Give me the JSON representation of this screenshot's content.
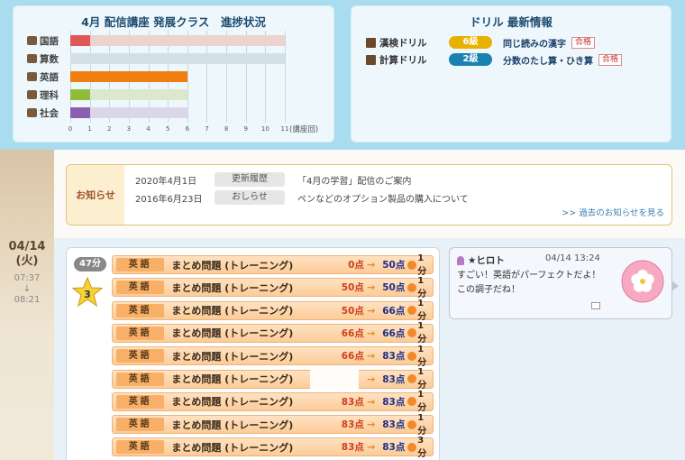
{
  "progress": {
    "title": "4月 配信講座 発展クラス　進捗状況",
    "unit": "(講座回)",
    "chart_data": {
      "type": "bar",
      "orientation": "horizontal",
      "categories": [
        "国語",
        "算数",
        "英語",
        "理科",
        "社会"
      ],
      "series": [
        {
          "values": [
            1,
            0,
            6,
            1,
            1
          ]
        }
      ],
      "totals": [
        11,
        11,
        6,
        6,
        6
      ],
      "colors": [
        "#e05757",
        "#a8bfd6",
        "#f07f10",
        "#8fbd3a",
        "#8a5fb0"
      ],
      "track_colors": [
        "#ecd3cf",
        "#d3e0e8",
        "#f7dcc0",
        "#dce8cc",
        "#dcd6ea"
      ],
      "xticks": [
        0,
        1,
        2,
        3,
        4,
        5,
        6,
        7,
        8,
        9,
        10,
        11
      ],
      "xlim": [
        0,
        11
      ]
    }
  },
  "drill": {
    "title": "ドリル 最新情報",
    "items": [
      {
        "name": "漢検ドリル",
        "level": "6級",
        "level_color": "#e8b100",
        "unit": "同じ読みの漢字",
        "result": "合格"
      },
      {
        "name": "計算ドリル",
        "level": "2級",
        "level_color": "#1a82b0",
        "unit": "分数のたし算・ひき算",
        "result": "合格"
      }
    ]
  },
  "notice": {
    "label": "お知らせ",
    "items": [
      {
        "date": "2020年4月1日",
        "tag": "更新履歴",
        "text": "「4月の学習」配信のご案内"
      },
      {
        "date": "2016年6月23日",
        "tag": "おしらせ",
        "text": "ペンなどのオプション製品の購入について"
      }
    ],
    "more": ">> 過去のお知らせを見る"
  },
  "day": {
    "date": "04/14",
    "weekday": "(火)",
    "start": "07:37",
    "sep": "↓",
    "end": "08:21"
  },
  "study": {
    "minutes": "47分",
    "stars": "3",
    "rows": [
      {
        "subject": "英語",
        "title": "まとめ問題 (トレーニング)",
        "from": "0点",
        "to": "50点",
        "time": "1分"
      },
      {
        "subject": "英語",
        "title": "まとめ問題 (トレーニング)",
        "from": "50点",
        "to": "50点",
        "time": "1分"
      },
      {
        "subject": "英語",
        "title": "まとめ問題 (トレーニング)",
        "from": "50点",
        "to": "66点",
        "time": "1分"
      },
      {
        "subject": "英語",
        "title": "まとめ問題 (トレーニング)",
        "from": "66点",
        "to": "66点",
        "time": "1分"
      },
      {
        "subject": "英語",
        "title": "まとめ問題 (トレーニング)",
        "from": "66点",
        "to": "83点",
        "time": "1分"
      },
      {
        "subject": "英語",
        "title": "まとめ問題 (トレーニング)",
        "from": "",
        "to": "83点",
        "time": "1分"
      },
      {
        "subject": "英語",
        "title": "まとめ問題 (トレーニング)",
        "from": "83点",
        "to": "83点",
        "time": "1分"
      },
      {
        "subject": "英語",
        "title": "まとめ問題 (トレーニング)",
        "from": "83点",
        "to": "83点",
        "time": "1分"
      },
      {
        "subject": "英語",
        "title": "まとめ問題 (トレーニング)",
        "from": "83点",
        "to": "83点",
        "time": "3分"
      }
    ]
  },
  "message": {
    "name": "★ヒロト",
    "time": "04/14 13:24",
    "lines": [
      "すごい！英語がパーフェクトだよ！",
      "この調子だね！"
    ],
    "badge_label": "たいへんよくできました"
  }
}
